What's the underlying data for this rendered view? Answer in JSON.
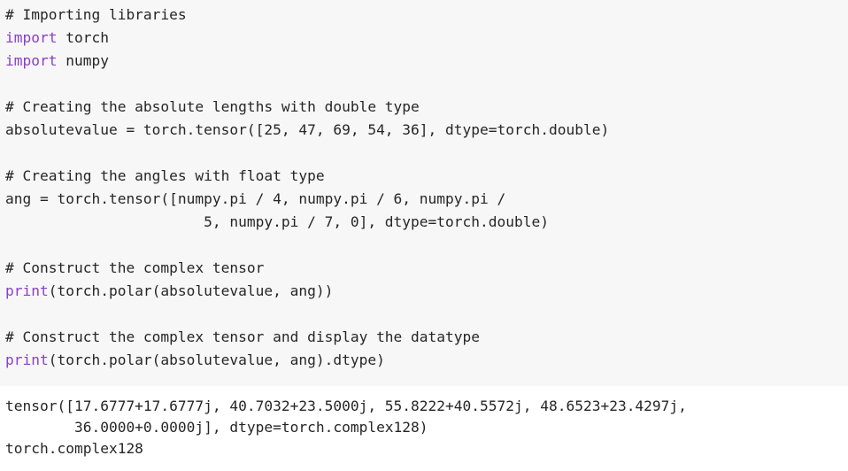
{
  "code_cell": {
    "lines": [
      {
        "type": "comment",
        "text": "# Importing libraries"
      },
      {
        "type": "import",
        "keyword": "import",
        "rest": " torch"
      },
      {
        "type": "import",
        "keyword": "import",
        "rest": " numpy"
      },
      {
        "type": "blank",
        "text": ""
      },
      {
        "type": "comment",
        "text": "# Creating the absolute lengths with double type"
      },
      {
        "type": "code",
        "text": "absolutevalue = torch.tensor([25, 47, 69, 54, 36], dtype=torch.double)"
      },
      {
        "type": "blank",
        "text": ""
      },
      {
        "type": "comment",
        "text": "# Creating the angles with float type"
      },
      {
        "type": "code",
        "text": "ang = torch.tensor([numpy.pi / 4, numpy.pi / 6, numpy.pi /"
      },
      {
        "type": "code",
        "text": "                       5, numpy.pi / 7, 0], dtype=torch.double)"
      },
      {
        "type": "blank",
        "text": ""
      },
      {
        "type": "comment",
        "text": "# Construct the complex tensor"
      },
      {
        "type": "print",
        "keyword": "print",
        "rest": "(torch.polar(absolutevalue, ang))"
      },
      {
        "type": "blank",
        "text": ""
      },
      {
        "type": "comment",
        "text": "# Construct the complex tensor and display the datatype"
      },
      {
        "type": "print",
        "keyword": "print",
        "rest": "(torch.polar(absolutevalue, ang).dtype)"
      }
    ]
  },
  "output_cell": {
    "lines": [
      "tensor([17.6777+17.6777j, 40.7032+23.5000j, 55.8222+40.5572j, 48.6523+23.4297j,",
      "        36.0000+0.0000j], dtype=torch.complex128)",
      "torch.complex128"
    ]
  },
  "colors": {
    "code_background": "#f7f7f7",
    "output_background": "#ffffff",
    "keyword": "#8a3fc8",
    "text": "#262626"
  }
}
